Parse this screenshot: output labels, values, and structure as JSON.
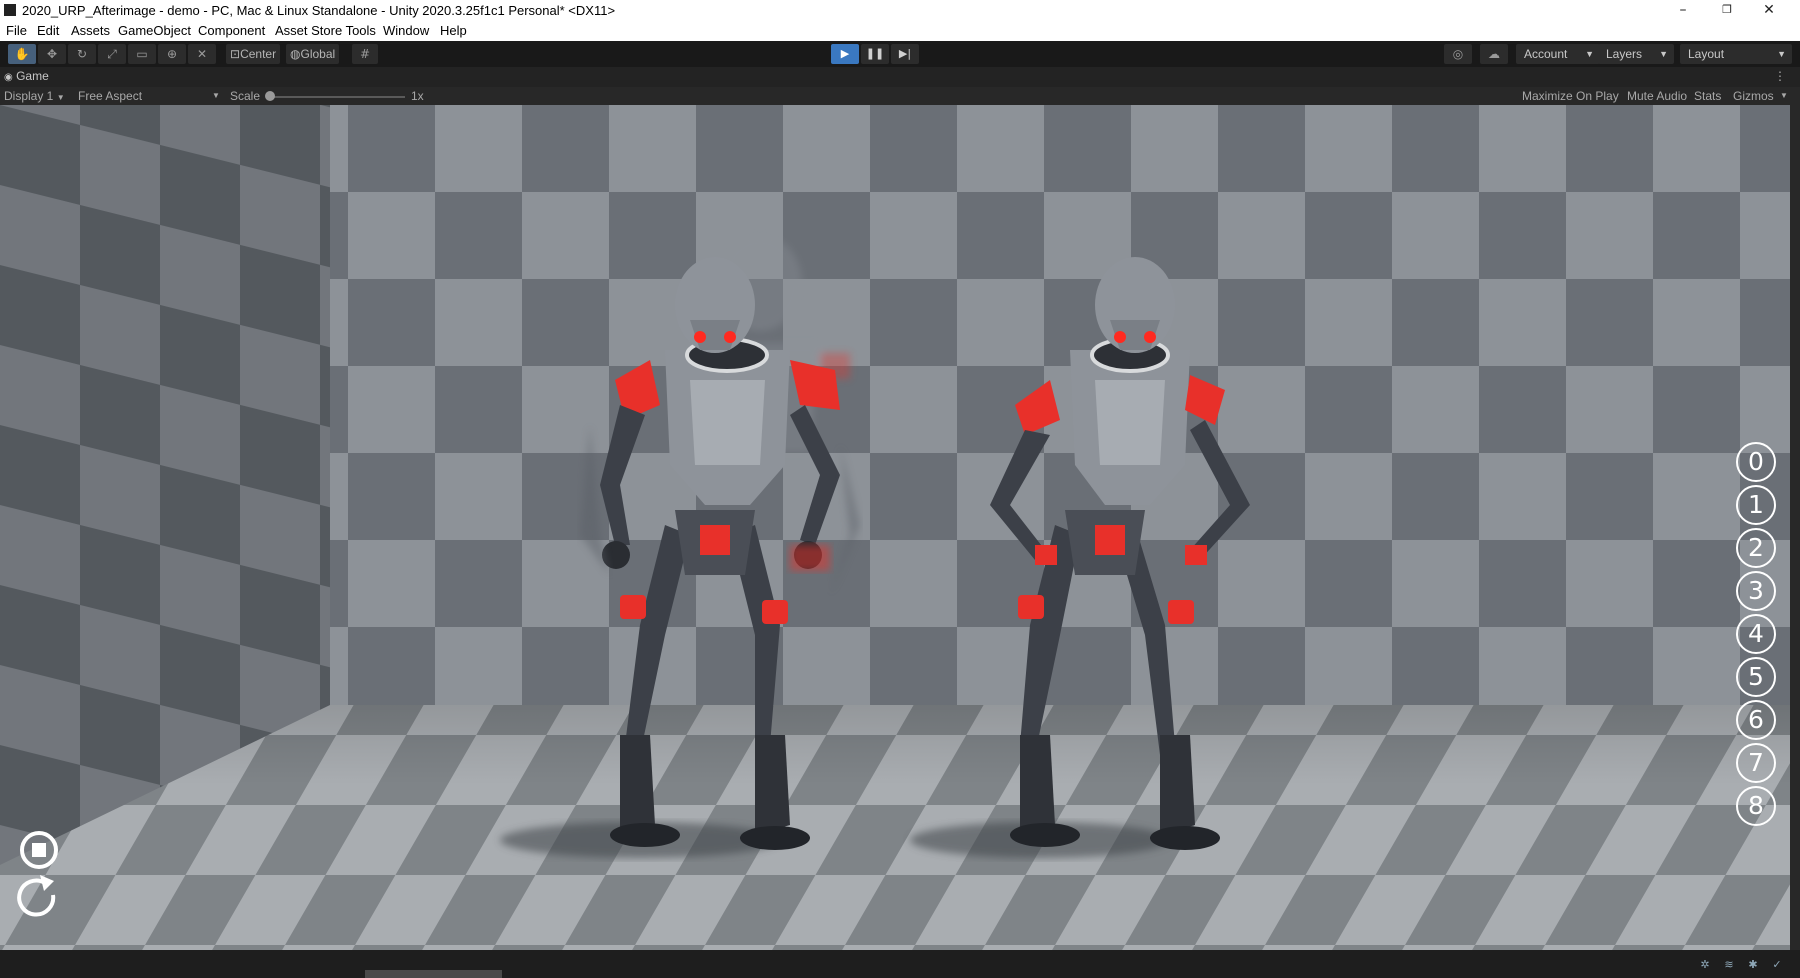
{
  "window": {
    "title": "2020_URP_Afterimage - demo - PC, Mac & Linux Standalone - Unity 2020.3.25f1c1 Personal* <DX11>",
    "minimize_glyph": "–",
    "restore_glyph": "❐",
    "close_glyph": "✕"
  },
  "menu": [
    "File",
    "Edit",
    "Assets",
    "GameObject",
    "Component",
    "Asset Store Tools",
    "Window",
    "Help"
  ],
  "toolbar": {
    "pivot_label": "Center",
    "space_label": "Global",
    "account_label": "Account",
    "layers_label": "Layers",
    "layout_label": "Layout"
  },
  "game_view": {
    "tab_label": "Game",
    "display": "Display 1",
    "aspect": "Free Aspect",
    "scale_label": "Scale",
    "scale_value": "1x",
    "maximize_on_play": "Maximize On Play",
    "mute_audio": "Mute Audio",
    "stats": "Stats",
    "gizmos": "Gizmos"
  },
  "scene": {
    "number_buttons": [
      "0",
      "1",
      "2",
      "3",
      "4",
      "5",
      "6",
      "7",
      "8"
    ],
    "icons": [
      "stop-icon",
      "restart-icon"
    ]
  },
  "colors": {
    "accent_blue": "#3a78c0",
    "robot_red": "#e8302a",
    "robot_body": "#4a4e56"
  }
}
